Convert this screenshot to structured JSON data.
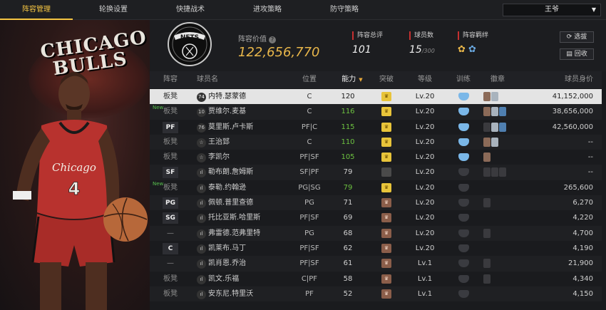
{
  "tabs": [
    {
      "label": "阵容管理",
      "active": true
    },
    {
      "label": "轮换设置",
      "active": false
    },
    {
      "label": "快捷战术",
      "active": false
    },
    {
      "label": "进攻策略",
      "active": false
    },
    {
      "label": "防守策略",
      "active": false
    }
  ],
  "team_selector": {
    "value": "王爷"
  },
  "hero": {
    "team_wordmark_line1": "CHICAGO",
    "team_wordmark_line2": "BULLS",
    "jersey_text": "Chicago",
    "jersey_number": "4"
  },
  "header": {
    "lineup_value_label": "阵容价值",
    "lineup_value": "122,656,770",
    "total_rating_label": "阵容总评",
    "total_rating": "101",
    "player_count_label": "球员数",
    "player_count": "15",
    "player_count_max": "/300",
    "chemistry_label": "阵容羁绊",
    "select_button": "选拔",
    "recycle_button": "回收"
  },
  "table": {
    "columns": [
      "阵容",
      "球员名",
      "位置",
      "能力",
      "突破",
      "等级",
      "训练",
      "徽章",
      "球员身价"
    ],
    "rows": [
      {
        "slot": "板凳",
        "slot_tag": false,
        "is_new": false,
        "badge_num": "74",
        "name": "内特.瑟蒙德",
        "pos": "C",
        "rating": "120",
        "rating_green": false,
        "breakthrough": "gold",
        "level": "Lv.20",
        "training": "blue",
        "emblems": [
          "bronze",
          "silver"
        ],
        "salary": "41,152,000",
        "selected": true
      },
      {
        "slot": "板凳",
        "slot_tag": false,
        "is_new": true,
        "badge_num": "10",
        "name": "贾维尔.麦基",
        "pos": "C",
        "rating": "116",
        "rating_green": true,
        "breakthrough": "gold",
        "level": "Lv.20",
        "training": "blue",
        "emblems": [
          "bronze",
          "silver",
          "blue"
        ],
        "salary": "38,656,000",
        "selected": false
      },
      {
        "slot": "PF",
        "slot_tag": true,
        "is_new": false,
        "badge_num": "76",
        "name": "莫里斯.卢卡斯",
        "pos": "PF|C",
        "rating": "115",
        "rating_green": true,
        "breakthrough": "gold",
        "level": "Lv.20",
        "training": "blue",
        "emblems": [
          "dark",
          "silver",
          "blue"
        ],
        "salary": "42,560,000",
        "selected": false
      },
      {
        "slot": "板凳",
        "slot_tag": false,
        "is_new": false,
        "badge_num": "☆",
        "name": "王治郅",
        "pos": "C",
        "rating": "110",
        "rating_green": true,
        "breakthrough": "gold",
        "level": "Lv.20",
        "training": "blue",
        "emblems": [
          "bronze",
          "silver"
        ],
        "salary": "--",
        "selected": false
      },
      {
        "slot": "板凳",
        "slot_tag": false,
        "is_new": false,
        "badge_num": "☆",
        "name": "李凯尔",
        "pos": "PF|SF",
        "rating": "105",
        "rating_green": true,
        "breakthrough": "gold",
        "level": "Lv.20",
        "training": "blue",
        "emblems": [
          "bronze"
        ],
        "salary": "--",
        "selected": false
      },
      {
        "slot": "SF",
        "slot_tag": true,
        "is_new": false,
        "badge_num": "ıl",
        "name": "勒布朗.詹姆斯",
        "pos": "SF|PF",
        "rating": "79",
        "rating_green": false,
        "breakthrough": "gray",
        "level": "Lv.20",
        "training": "gray",
        "emblems": [
          "dark",
          "dark",
          "dark"
        ],
        "salary": "--",
        "selected": false
      },
      {
        "slot": "板凳",
        "slot_tag": false,
        "is_new": true,
        "badge_num": "ıl",
        "name": "泰勒.约翰逊",
        "pos": "PG|SG",
        "rating": "79",
        "rating_green": true,
        "breakthrough": "gold",
        "level": "Lv.20",
        "training": "gray",
        "emblems": [],
        "salary": "265,600",
        "selected": false
      },
      {
        "slot": "PG",
        "slot_tag": true,
        "is_new": false,
        "badge_num": "ıl",
        "name": "佩顿.普里查德",
        "pos": "PG",
        "rating": "71",
        "rating_green": false,
        "breakthrough": "brown",
        "level": "Lv.20",
        "training": "gray",
        "emblems": [
          "dark"
        ],
        "salary": "6,270",
        "selected": false
      },
      {
        "slot": "SG",
        "slot_tag": true,
        "is_new": false,
        "badge_num": "ıl",
        "name": "托比亚斯.哈里斯",
        "pos": "PF|SF",
        "rating": "69",
        "rating_green": false,
        "breakthrough": "brown",
        "level": "Lv.20",
        "training": "gray",
        "emblems": [],
        "salary": "4,220",
        "selected": false
      },
      {
        "slot": "—",
        "slot_tag": false,
        "is_new": false,
        "badge_num": "ıl",
        "name": "弗雷德.范弗里特",
        "pos": "PG",
        "rating": "68",
        "rating_green": false,
        "breakthrough": "brown",
        "level": "Lv.20",
        "training": "gray",
        "emblems": [
          "dark"
        ],
        "salary": "4,700",
        "selected": false
      },
      {
        "slot": "C",
        "slot_tag": true,
        "is_new": false,
        "badge_num": "ıl",
        "name": "凯莱布.马丁",
        "pos": "PF|SF",
        "rating": "62",
        "rating_green": false,
        "breakthrough": "brown",
        "level": "Lv.20",
        "training": "gray",
        "emblems": [],
        "salary": "4,190",
        "selected": false
      },
      {
        "slot": "—",
        "slot_tag": false,
        "is_new": false,
        "badge_num": "ıl",
        "name": "凯肖恩.乔治",
        "pos": "PF|SF",
        "rating": "61",
        "rating_green": false,
        "breakthrough": "brown",
        "level": "Lv.1",
        "training": "gray",
        "emblems": [
          "dark"
        ],
        "salary": "21,900",
        "selected": false
      },
      {
        "slot": "板凳",
        "slot_tag": false,
        "is_new": false,
        "badge_num": "ıl",
        "name": "凯文.乐福",
        "pos": "C|PF",
        "rating": "58",
        "rating_green": false,
        "breakthrough": "brown",
        "level": "Lv.1",
        "training": "gray",
        "emblems": [
          "dark"
        ],
        "salary": "4,340",
        "selected": false
      },
      {
        "slot": "板凳",
        "slot_tag": false,
        "is_new": false,
        "badge_num": "ıl",
        "name": "安东尼.特里沃",
        "pos": "PF",
        "rating": "52",
        "rating_green": false,
        "breakthrough": "brown",
        "level": "Lv.1",
        "training": "gray",
        "emblems": [],
        "salary": "4,150",
        "selected": false
      }
    ]
  }
}
